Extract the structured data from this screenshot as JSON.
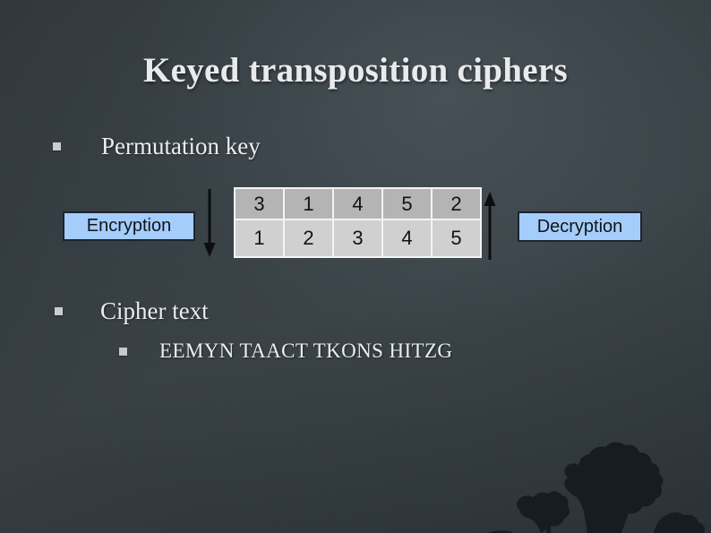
{
  "slide": {
    "title": "Keyed transposition ciphers",
    "background_color": "#323a3f",
    "text_color": "#ecedee"
  },
  "bullets": [
    {
      "id": "permutation-key",
      "marker": "square-bullet",
      "text": "Permutation key",
      "level": 1
    },
    {
      "id": "cipher-text",
      "marker": "square-bullet",
      "text": "Cipher text",
      "level": 1
    },
    {
      "id": "cipher-text-value",
      "marker": "square-bullet",
      "text": "EEMYN TAACT TKONS HITZG",
      "level": 2
    }
  ],
  "permutation_table": {
    "rows": [
      {
        "name": "key-row",
        "background": "#b4b4b4",
        "cells": [
          "3",
          "1",
          "4",
          "5",
          "2"
        ]
      },
      {
        "name": "position-row",
        "background": "#d0d0d0",
        "cells": [
          "1",
          "2",
          "3",
          "4",
          "5"
        ]
      }
    ],
    "border_color": "#f4f4f4"
  },
  "callouts": {
    "encryption": {
      "label": "Encryption",
      "fill": "#a5cdfb",
      "border": "#1c2430"
    },
    "decryption": {
      "label": "Decryption",
      "fill": "#a5cdfb",
      "border": "#1c2430"
    }
  },
  "arrows": [
    {
      "name": "encryption-arrow",
      "direction": "down",
      "color": "#0a0d11"
    },
    {
      "name": "decryption-arrow",
      "direction": "up",
      "color": "#0a0d11"
    }
  ],
  "decoration": {
    "tree": "tree-silhouette"
  }
}
